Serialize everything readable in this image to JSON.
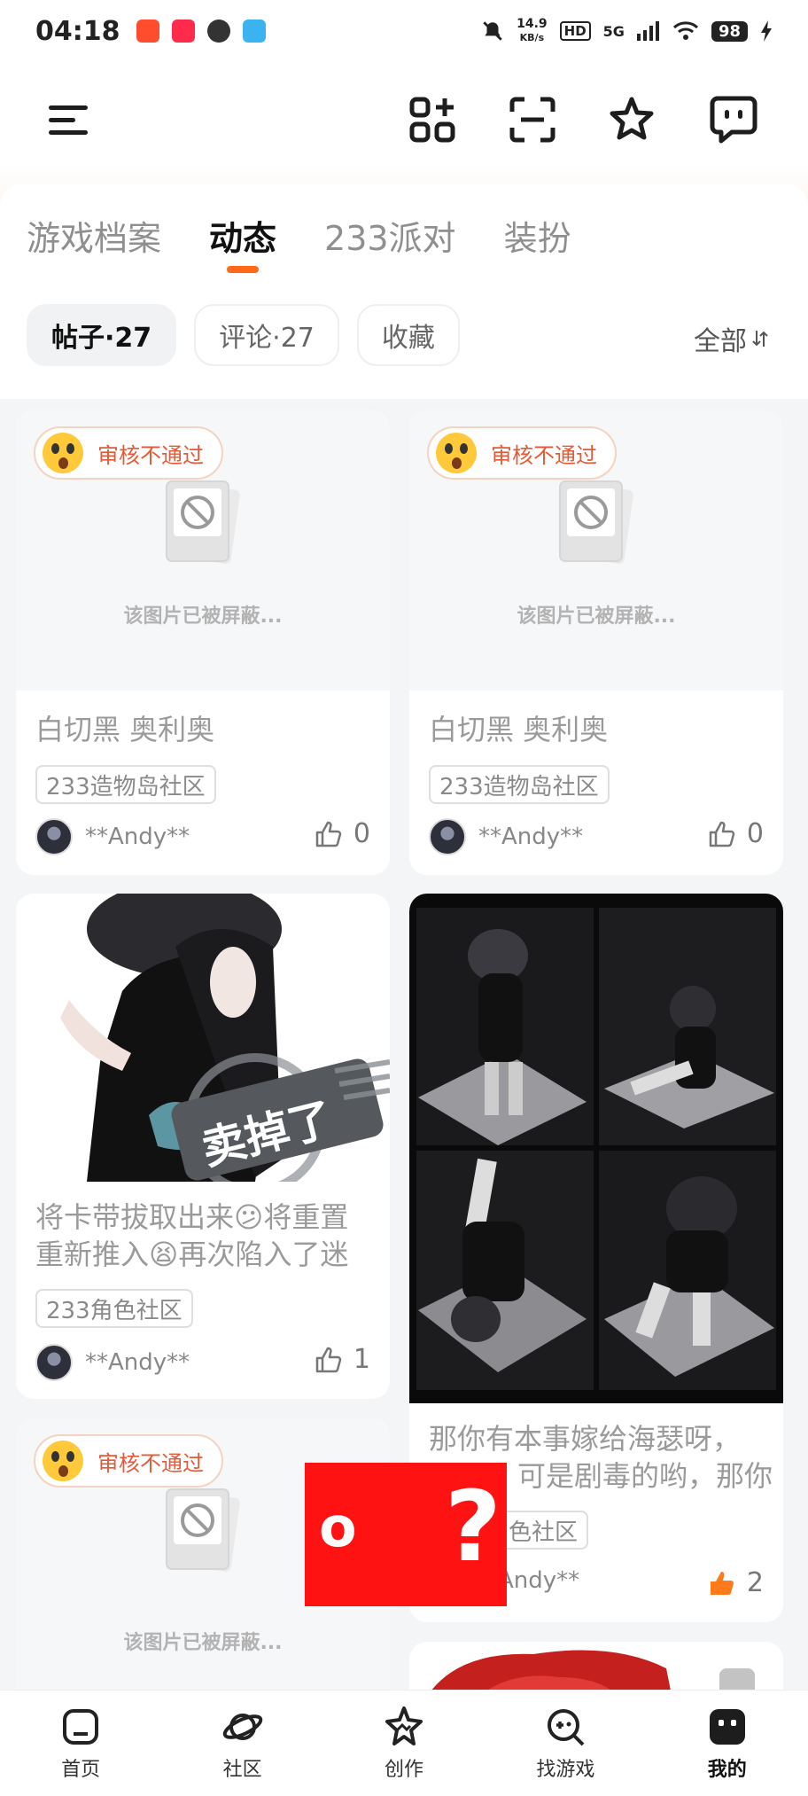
{
  "status_bar": {
    "time": "04:18",
    "net_speed_top": "14.9",
    "net_speed_unit": "KB/s",
    "hd": "HD",
    "signal": "5G",
    "battery": "98"
  },
  "tabs": [
    {
      "label": "游戏档案"
    },
    {
      "label": "动态"
    },
    {
      "label": "233派对"
    },
    {
      "label": "装扮"
    }
  ],
  "active_tab": "动态",
  "filters": [
    {
      "label": "帖子·27"
    },
    {
      "label": "评论·27"
    },
    {
      "label": "收藏"
    }
  ],
  "sort": {
    "label": "全部"
  },
  "posts": [
    {
      "badge": "审核不通过",
      "blocked_text": "该图片已被屏蔽...",
      "title": "白切黑 奥利奥",
      "tag": "233造物岛社区",
      "author": "**Andy**",
      "likes": "0"
    },
    {
      "badge": "审核不通过",
      "blocked_text": "该图片已被屏蔽...",
      "title": "白切黑 奥利奥",
      "tag": "233造物岛社区",
      "author": "**Andy**",
      "likes": "0"
    },
    {
      "title_line1": "将卡带拔取出来😕将重置",
      "title_line2": "重新推入😫再次陷入了迷",
      "tag": "233角色社区",
      "author": "**Andy**",
      "likes": "1",
      "stamp": "卖掉了"
    },
    {
      "title_line1": "那你有本事嫁给海瑟呀，",
      "title_line2": "可是剧毒的哟，那你",
      "tag": "色社区",
      "author": "Andy**",
      "likes": "2"
    },
    {
      "badge": "审核不通过",
      "blocked_text": "该图片已被屏蔽..."
    }
  ],
  "overlay": {
    "text_left": "o",
    "text_right": "?"
  },
  "bottom_nav": [
    {
      "label": "首页"
    },
    {
      "label": "社区"
    },
    {
      "label": "创作"
    },
    {
      "label": "找游戏"
    },
    {
      "label": "我的"
    }
  ],
  "colors": {
    "accent": "#ff6a1a",
    "badge_text": "#e45a36",
    "like_active": "#ff7a1a"
  }
}
